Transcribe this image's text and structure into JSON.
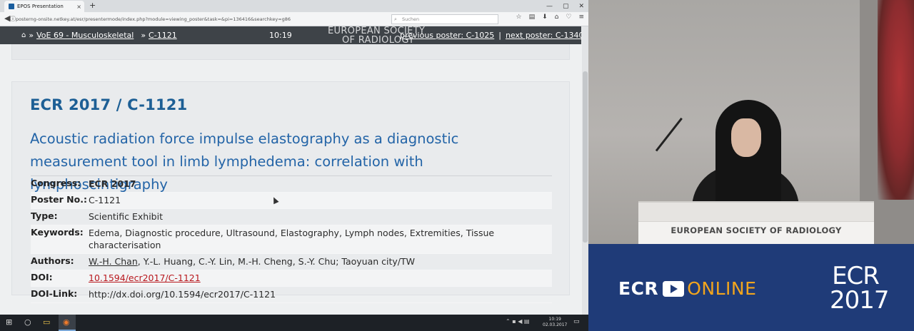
{
  "browser": {
    "tab_title": "EPOS Presentation",
    "tab_close": "×",
    "new_tab": "+",
    "window_controls": [
      "—",
      "▢",
      "✕"
    ],
    "url": "posterng-onsite.netkey.at/esr/presentermode/index.php?module=viewing_poster&task=&pi=136416&searchkey=g86",
    "search_placeholder": "Suchen",
    "back": "◀",
    "info": "ⓘ",
    "toolbar_icons": [
      "☆",
      "▤",
      "⬇",
      "⌂",
      "♡",
      "≡"
    ]
  },
  "posterbar": {
    "home_icon": "⌂",
    "sep1": "»",
    "section": "VoE 69 - Musculoskeletal",
    "sep2": "»",
    "poster_code": "C-1121",
    "clock": "10:19",
    "logo_line1": "EUROPEAN SOCIETY",
    "logo_line2": "OF RADIOLOGY",
    "previous": "previous poster: C-1025",
    "divider": "|",
    "next": "next poster: C-1340"
  },
  "poster": {
    "id": "ECR 2017 / C-1121",
    "title": "Acoustic radiation force impulse elastography as a diagnostic measurement tool in limb lymphedema: correlation with lymphoscintigraphy",
    "meta": {
      "congress_label": "Congress:",
      "congress": "ECR 2017",
      "poster_no_label": "Poster No.:",
      "poster_no": "C-1121",
      "type_label": "Type:",
      "type": "Scientific Exhibit",
      "keywords_label": "Keywords:",
      "keywords": "Edema, Diagnostic procedure, Ultrasound, Elastography, Lymph nodes, Extremities, Tissue characterisation",
      "authors_label": "Authors:",
      "first_author": "W.-H. Chan",
      "other_authors": ", Y.-L. Huang, C.-Y. Lin, M.-H. Cheng, S.-Y. Chu; Taoyuan city/TW",
      "doi_label": "DOI:",
      "doi": "10.1594/ecr2017/C-1121",
      "doi_link_label": "DOI-Link:",
      "doi_link": "http://dx.doi.org/10.1594/ecr2017/C-1121"
    }
  },
  "taskbar": {
    "start": "⊞",
    "search": "○",
    "explorer": "▭",
    "firefox": "◉",
    "tray": "⌃ ▪ ◀ ▤",
    "time": "10:19",
    "date": "02.03.2017",
    "notify": "▭"
  },
  "video": {
    "podium_text": "EUROPEAN SOCIETY OF RADIOLOGY"
  },
  "banner": {
    "ecr": "ECR",
    "online": "ONLINE",
    "ecr_big": "ECR",
    "year": "2017",
    "colors": {
      "navy": "#1f3b78",
      "orange": "#f2a51d"
    }
  }
}
